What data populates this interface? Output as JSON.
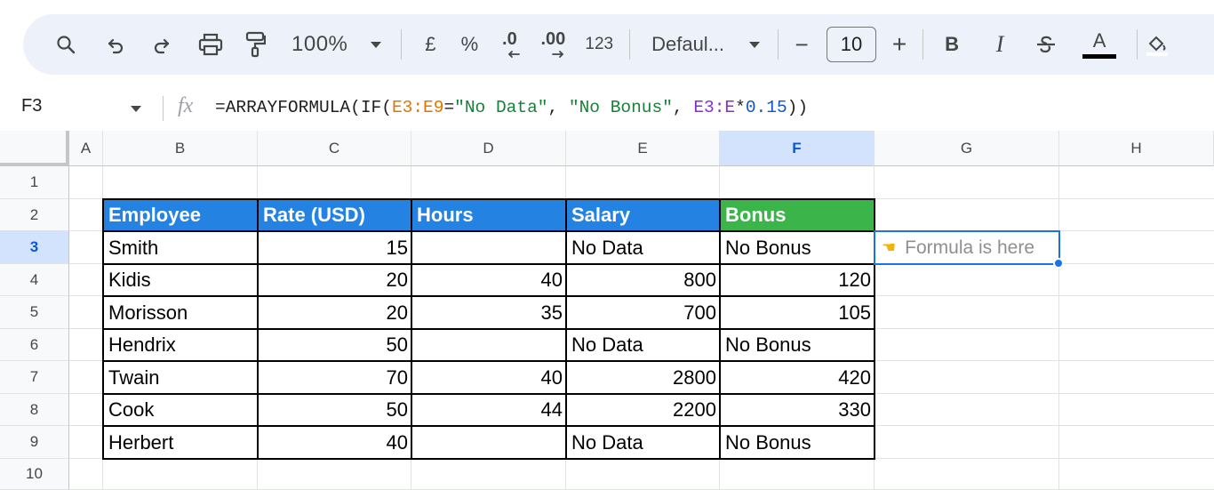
{
  "toolbar": {
    "zoom": "100%",
    "currency_label": "£",
    "percent_label": "%",
    "decimal_decrease_label": ".0",
    "decimal_increase_label": ".00",
    "number_format_label": "123",
    "font_name": "Defaul...",
    "font_size": "10",
    "minus_label": "−",
    "plus_label": "+",
    "bold_label": "B",
    "italic_label": "I",
    "text_color_label": "A"
  },
  "formula_bar": {
    "cell_ref": "F3",
    "fx_label": "fx",
    "formula": {
      "p1": "=ARRAYFORMULA(IF(",
      "r1": "E3:E9",
      "p2": "=",
      "s1": "\"No Data\"",
      "p3": ", ",
      "s2": "\"No Bonus\"",
      "p4": ", ",
      "r2": "E3:E",
      "p5": "*",
      "n1": "0.15",
      "p6": "))"
    }
  },
  "columns": [
    "A",
    "B",
    "C",
    "D",
    "E",
    "F",
    "G",
    "H"
  ],
  "rows": [
    "1",
    "2",
    "3",
    "4",
    "5",
    "6",
    "7",
    "8",
    "9",
    "10"
  ],
  "active_cell": "F3",
  "table": {
    "headers": [
      "Employee",
      "Rate (USD)",
      "Hours",
      "Salary",
      "Bonus"
    ],
    "rows": [
      [
        "Smith",
        "15",
        "",
        "No Data",
        "No Bonus"
      ],
      [
        "Kidis",
        "20",
        "40",
        "800",
        "120"
      ],
      [
        "Morisson",
        "20",
        "35",
        "700",
        "105"
      ],
      [
        "Hendrix",
        "50",
        "",
        "No Data",
        "No Bonus"
      ],
      [
        "Twain",
        "70",
        "40",
        "2800",
        "420"
      ],
      [
        "Cook",
        "50",
        "44",
        "2200",
        "330"
      ],
      [
        "Herbert",
        "40",
        "",
        "No Data",
        "No Bonus"
      ]
    ]
  },
  "note": {
    "icon": "pointing-hand-icon",
    "text": "Formula is here"
  },
  "colors": {
    "header_blue": "#2382e2",
    "header_green": "#3bb44a",
    "selection": "#1a73e8",
    "toolbar_bg": "#edf2fa"
  }
}
